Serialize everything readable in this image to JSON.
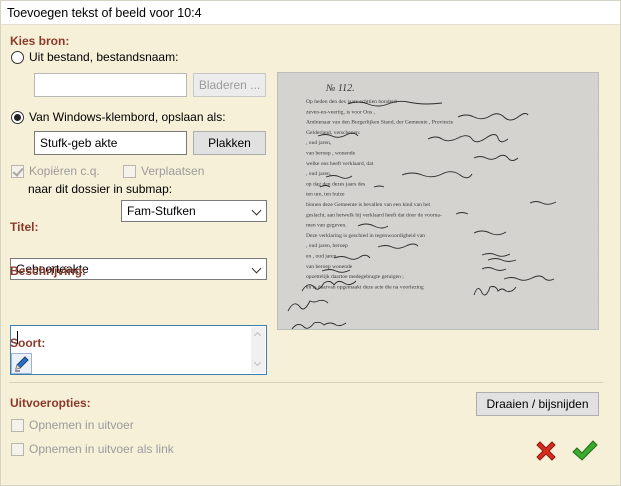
{
  "window": {
    "title": "Toevoegen tekst of beeld voor 10:4"
  },
  "source": {
    "heading": "Kies bron:",
    "file_option_label": "Uit bestand, bestandsnaam:",
    "file_name_value": "",
    "browse_label": "Bladeren ...",
    "clipboard_option_label": "Van Windows-klembord, opslaan als:",
    "clipboard_name_value": "Stufk-geb akte",
    "paste_label": "Plakken",
    "copy_label": "Kopiëren c.q.",
    "move_label": "Verplaatsen",
    "submap_label": "naar dit dossier in submap:",
    "submap_value": "Fam-Stufken"
  },
  "title_field": {
    "label": "Titel:",
    "value": "Geboorteakte"
  },
  "description": {
    "label": "Beschrijving:",
    "value": ""
  },
  "kind": {
    "label": "Soort:",
    "icon": "pen-icon"
  },
  "output": {
    "heading": "Uitvoeropties:",
    "include_label": "Opnemen in uitvoer",
    "include_link_label": "Opnemen in uitvoer als link",
    "rotate_crop_label": "Draaien / bijsnijden"
  },
  "document_preview": {
    "number": "№ 112.",
    "lines": [
      "Op heden den                          des jaars achttien honderd",
      "zeven-en-veertig, is voor Ons                        ,",
      "Ambtenaar van den Burgerlijken Stand, der Gemeente                 , Provincie",
      "Gelderland, verschenen:",
      "                                    , oud                   jaren,",
      "van beroep                 , wonende",
      "welke ons heeft verklaard, dat",
      "                     , oud                   jaren,",
      "op            dag den                          dezes jaars des",
      "               ten           ure, ten         huize",
      "binnen deze Gemeente is bevallen van een kind van het",
      "geslacht, aan hetwelk hij verklaard heeft dat door           de voorna-",
      "men van                                    gegeven.",
      "Deze verklaring is geschied in tegenwoordigheid van",
      "                  , oud             jaren,          beroep",
      "en                         , oud            jaren,",
      "van           beroep              wonende",
      "                                        opzettelijk daartoe medegebragte getuigen ;",
      "en is daarvan opgemaakt deze acte die na voorlezing"
    ]
  },
  "colors": {
    "background": "#f6f0d8",
    "section_label": "#8a3a2a",
    "cancel": "#d62b1e",
    "ok": "#2e9d2a"
  }
}
